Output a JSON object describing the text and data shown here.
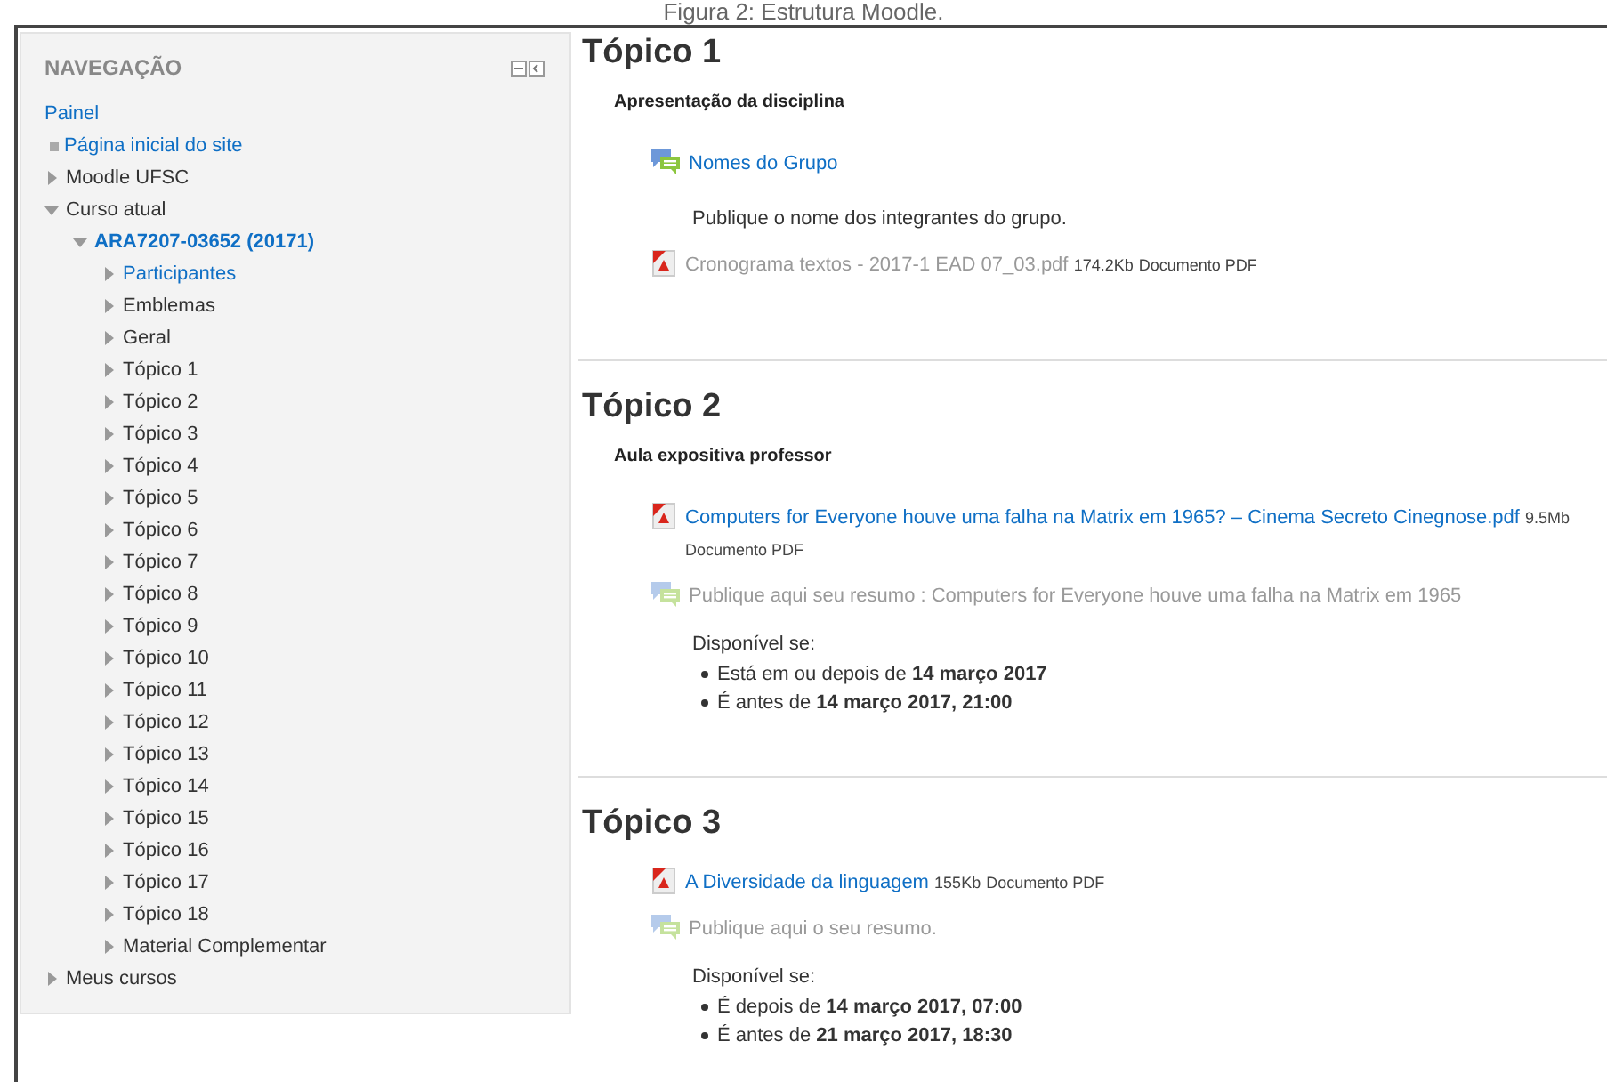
{
  "caption": "Figura 2: Estrutura Moodle.",
  "navigation": {
    "title": "NAVEGAÇÃO",
    "items": [
      {
        "label": "Painel",
        "kind": "plain",
        "link": true,
        "current": false
      },
      {
        "label": "Página inicial do site",
        "kind": "bullet",
        "link": true,
        "current": false
      },
      {
        "label": "Moodle UFSC",
        "kind": "branch",
        "expanded": false,
        "link": false,
        "current": false
      },
      {
        "label": "Curso atual",
        "kind": "branch",
        "expanded": true,
        "link": false,
        "current": false,
        "children": [
          {
            "label": "ARA7207-03652 (20171)",
            "kind": "branch",
            "expanded": true,
            "link": true,
            "current": true,
            "children": [
              {
                "label": "Participantes",
                "kind": "branch",
                "expanded": false,
                "link": true,
                "current": false
              },
              {
                "label": "Emblemas",
                "kind": "branch",
                "expanded": false,
                "link": false,
                "current": false
              },
              {
                "label": "Geral",
                "kind": "branch",
                "expanded": false,
                "link": false,
                "current": false
              },
              {
                "label": "Tópico 1",
                "kind": "branch",
                "expanded": false,
                "link": false,
                "current": false
              },
              {
                "label": "Tópico 2",
                "kind": "branch",
                "expanded": false,
                "link": false,
                "current": false
              },
              {
                "label": "Tópico 3",
                "kind": "branch",
                "expanded": false,
                "link": false,
                "current": false
              },
              {
                "label": "Tópico 4",
                "kind": "branch",
                "expanded": false,
                "link": false,
                "current": false
              },
              {
                "label": "Tópico 5",
                "kind": "branch",
                "expanded": false,
                "link": false,
                "current": false
              },
              {
                "label": "Tópico 6",
                "kind": "branch",
                "expanded": false,
                "link": false,
                "current": false
              },
              {
                "label": "Tópico 7",
                "kind": "branch",
                "expanded": false,
                "link": false,
                "current": false
              },
              {
                "label": "Tópico 8",
                "kind": "branch",
                "expanded": false,
                "link": false,
                "current": false
              },
              {
                "label": "Tópico 9",
                "kind": "branch",
                "expanded": false,
                "link": false,
                "current": false
              },
              {
                "label": "Tópico 10",
                "kind": "branch",
                "expanded": false,
                "link": false,
                "current": false
              },
              {
                "label": "Tópico 11",
                "kind": "branch",
                "expanded": false,
                "link": false,
                "current": false
              },
              {
                "label": "Tópico 12",
                "kind": "branch",
                "expanded": false,
                "link": false,
                "current": false
              },
              {
                "label": "Tópico 13",
                "kind": "branch",
                "expanded": false,
                "link": false,
                "current": false
              },
              {
                "label": "Tópico 14",
                "kind": "branch",
                "expanded": false,
                "link": false,
                "current": false
              },
              {
                "label": "Tópico 15",
                "kind": "branch",
                "expanded": false,
                "link": false,
                "current": false
              },
              {
                "label": "Tópico 16",
                "kind": "branch",
                "expanded": false,
                "link": false,
                "current": false
              },
              {
                "label": "Tópico 17",
                "kind": "branch",
                "expanded": false,
                "link": false,
                "current": false
              },
              {
                "label": "Tópico 18",
                "kind": "branch",
                "expanded": false,
                "link": false,
                "current": false
              },
              {
                "label": "Material Complementar",
                "kind": "branch",
                "expanded": false,
                "link": false,
                "current": false
              }
            ]
          }
        ]
      },
      {
        "label": "Meus cursos",
        "kind": "branch",
        "expanded": false,
        "link": false,
        "current": false
      }
    ]
  },
  "sections": [
    {
      "title": "Tópico 1",
      "summary": "Apresentação da disciplina",
      "activities": [
        {
          "kind": "forum",
          "name": "Nomes do Grupo",
          "dimmed": false,
          "description": "Publique o nome dos integrantes do grupo."
        },
        {
          "kind": "pdf",
          "name": "Cronograma textos - 2017-1 EAD 07_03.pdf",
          "size": "174.2Kb",
          "filetype": "Documento PDF",
          "dimmed": true
        }
      ]
    },
    {
      "title": "Tópico 2",
      "summary": "Aula expositiva professor",
      "activities": [
        {
          "kind": "pdf",
          "name": "Computers for Everyone houve uma falha na Matrix em 1965? – Cinema Secreto Cinegnose.pdf",
          "size": "9.5Mb",
          "filetype": "Documento PDF",
          "dimmed": false
        },
        {
          "kind": "forum",
          "name": "Publique aqui seu resumo : Computers for Everyone houve uma falha na Matrix em 1965",
          "dimmed": true,
          "availability": {
            "heading": "Disponível se:",
            "conditions": [
              "Está em ou depois de **14 março 2017**",
              "É antes de **14 março 2017, 21:00**"
            ]
          }
        }
      ]
    },
    {
      "title": "Tópico 3",
      "activities": [
        {
          "kind": "pdf",
          "name": "A Diversidade da linguagem",
          "size": "155Kb",
          "filetype": "Documento PDF",
          "dimmed": false
        },
        {
          "kind": "forum",
          "name": "Publique aqui o seu resumo.",
          "dimmed": true,
          "availability": {
            "heading": "Disponível se:",
            "conditions": [
              "É depois de **14 março 2017, 07:00**",
              "É antes de **21 março 2017, 18:30**"
            ]
          }
        }
      ]
    }
  ]
}
